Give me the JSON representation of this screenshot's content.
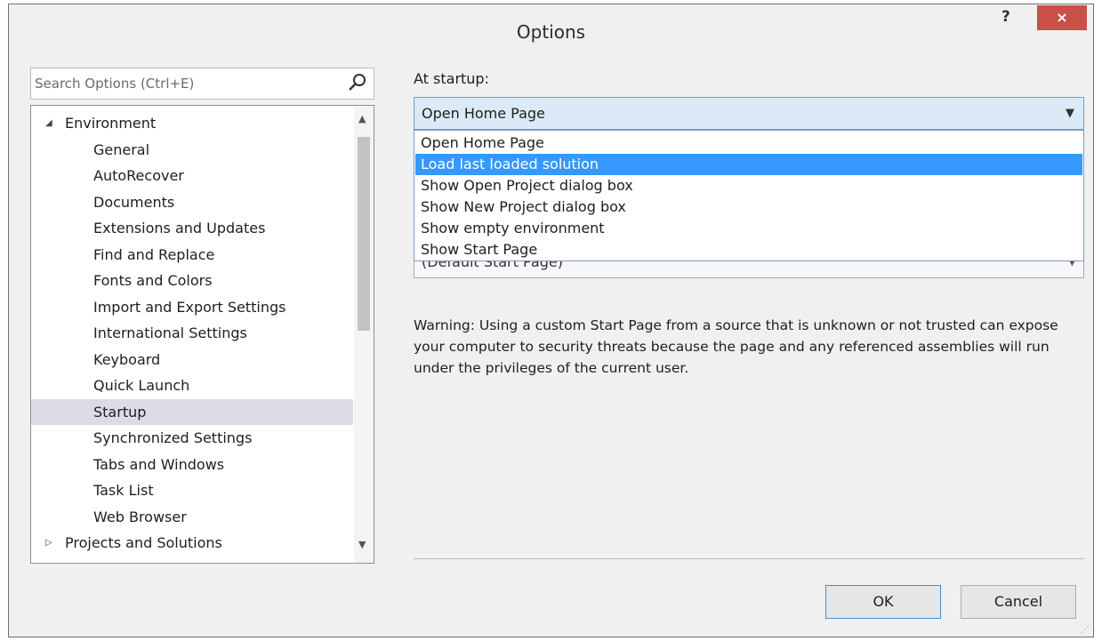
{
  "window": {
    "title": "Options",
    "help_label": "?",
    "close_label": "×"
  },
  "search": {
    "placeholder": "Search Options (Ctrl+E)"
  },
  "tree": {
    "items": [
      {
        "label": "Environment",
        "expanded": true,
        "level": 0
      },
      {
        "label": "General",
        "level": 1
      },
      {
        "label": "AutoRecover",
        "level": 1
      },
      {
        "label": "Documents",
        "level": 1
      },
      {
        "label": "Extensions and Updates",
        "level": 1
      },
      {
        "label": "Find and Replace",
        "level": 1
      },
      {
        "label": "Fonts and Colors",
        "level": 1
      },
      {
        "label": "Import and Export Settings",
        "level": 1
      },
      {
        "label": "International Settings",
        "level": 1
      },
      {
        "label": "Keyboard",
        "level": 1
      },
      {
        "label": "Quick Launch",
        "level": 1
      },
      {
        "label": "Startup",
        "level": 1,
        "selected": true
      },
      {
        "label": "Synchronized Settings",
        "level": 1
      },
      {
        "label": "Tabs and Windows",
        "level": 1
      },
      {
        "label": "Task List",
        "level": 1
      },
      {
        "label": "Web Browser",
        "level": 1
      },
      {
        "label": "Projects and Solutions",
        "expanded": false,
        "level": 0
      }
    ]
  },
  "startup": {
    "label": "At startup:",
    "selected": "Open Home Page",
    "options": [
      "Open Home Page",
      "Load last loaded solution",
      "Show Open Project dialog box",
      "Show New Project dialog box",
      "Show empty environment",
      "Show Start Page"
    ],
    "highlighted_index": 1,
    "highlight_color": "#3399ff"
  },
  "start_page": {
    "value": "(Default Start Page)"
  },
  "warning": "Warning: Using a custom Start Page from a source that is unknown or not trusted can expose your computer to security threats because the page and any referenced assemblies will run under the privileges of the current user.",
  "buttons": {
    "ok": "OK",
    "cancel": "Cancel"
  },
  "colors": {
    "close_button": "#c9514a",
    "selected_tree_row": "#dcdce6"
  }
}
